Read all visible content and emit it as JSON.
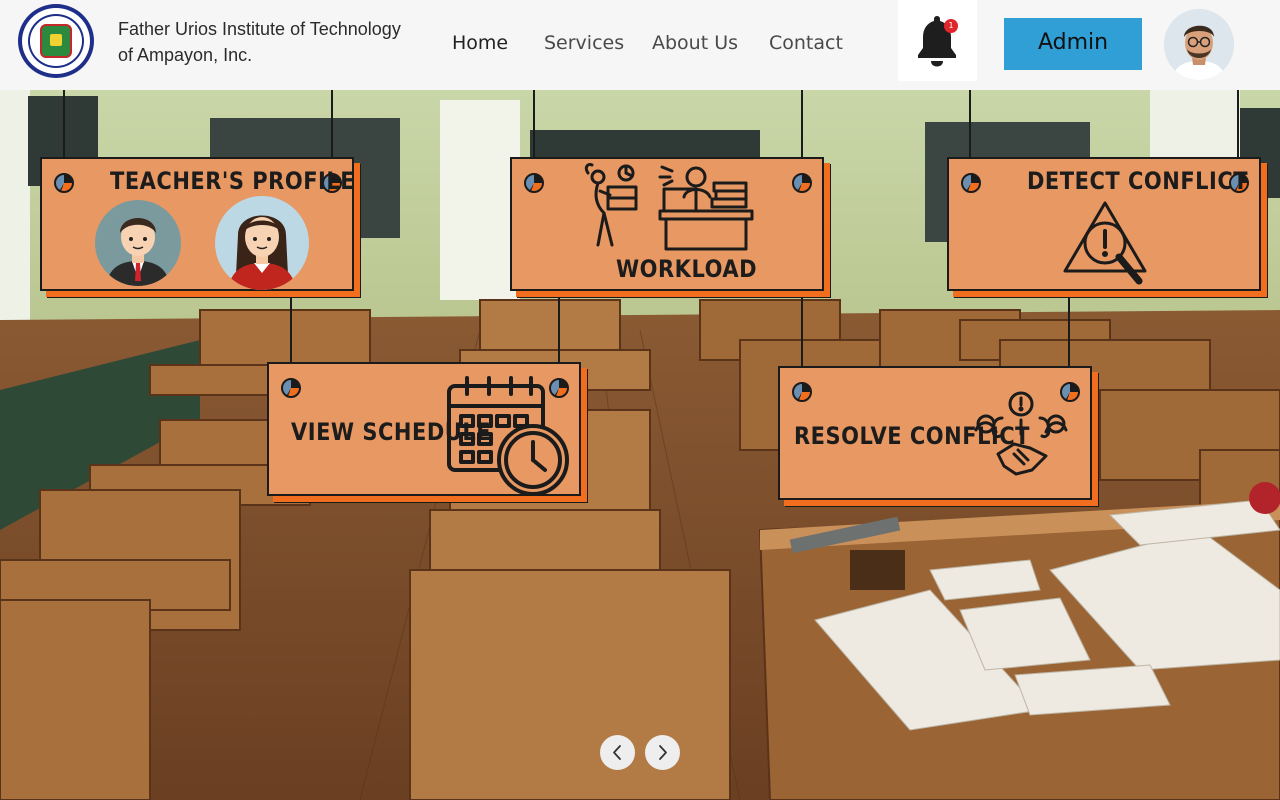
{
  "header": {
    "school_name_line1": "Father Urios Institute of Technology",
    "school_name_line2": "of Ampayon, Inc.",
    "logo_icon": "school-seal-logo"
  },
  "nav": {
    "items": [
      "Home",
      "Services",
      "About Us",
      "Contact"
    ],
    "active": "Home"
  },
  "notifications": {
    "count": "1",
    "icon": "bell-icon"
  },
  "admin_button": {
    "label": "Admin"
  },
  "user": {
    "avatar_icon": "user-avatar"
  },
  "cards": {
    "teachers_profile": {
      "title": "TEACHER'S PROFILE"
    },
    "workload": {
      "title": "WORKLOAD"
    },
    "detect_conflict": {
      "title": "DETECT CONFLICT"
    },
    "view_schedule": {
      "title": "VIEW SCHEDULE"
    },
    "resolve_conflict": {
      "title": "RESOLVE CONFLICT"
    }
  },
  "carousel": {
    "prev_icon": "chevron-left-icon",
    "next_icon": "chevron-right-icon"
  },
  "colors": {
    "card_fill": "#e89862",
    "card_shadow": "#f06e1e",
    "admin_button": "#2f9fd6",
    "badge": "#e0262b",
    "header_bg": "#f6f6f6"
  }
}
